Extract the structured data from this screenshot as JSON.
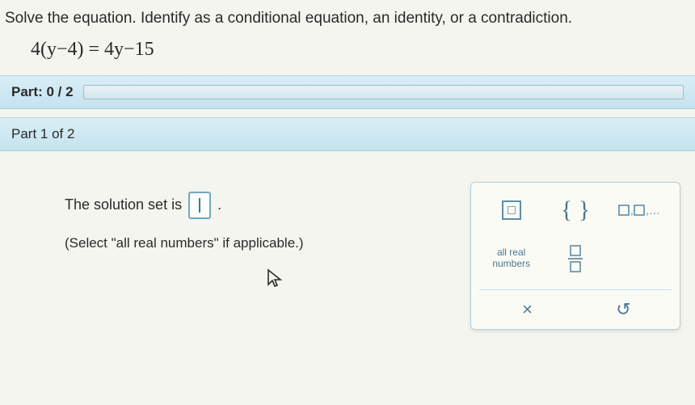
{
  "prompt": "Solve the equation. Identify as a conditional equation, an identity, or a contradiction.",
  "equation": "4(y−4) = 4y−15",
  "progress": {
    "label": "Part: 0 / 2"
  },
  "part_header": "Part 1 of 2",
  "solution": {
    "prefix": "The solution set is",
    "suffix": ".",
    "hint": "(Select \"all real numbers\" if applicable.)"
  },
  "keypad": {
    "interval": "interval",
    "braces": "{ }",
    "sequence": "□,□,...",
    "all_real": "all real numbers",
    "fraction": "fraction",
    "clear": "×",
    "undo": "↺"
  }
}
